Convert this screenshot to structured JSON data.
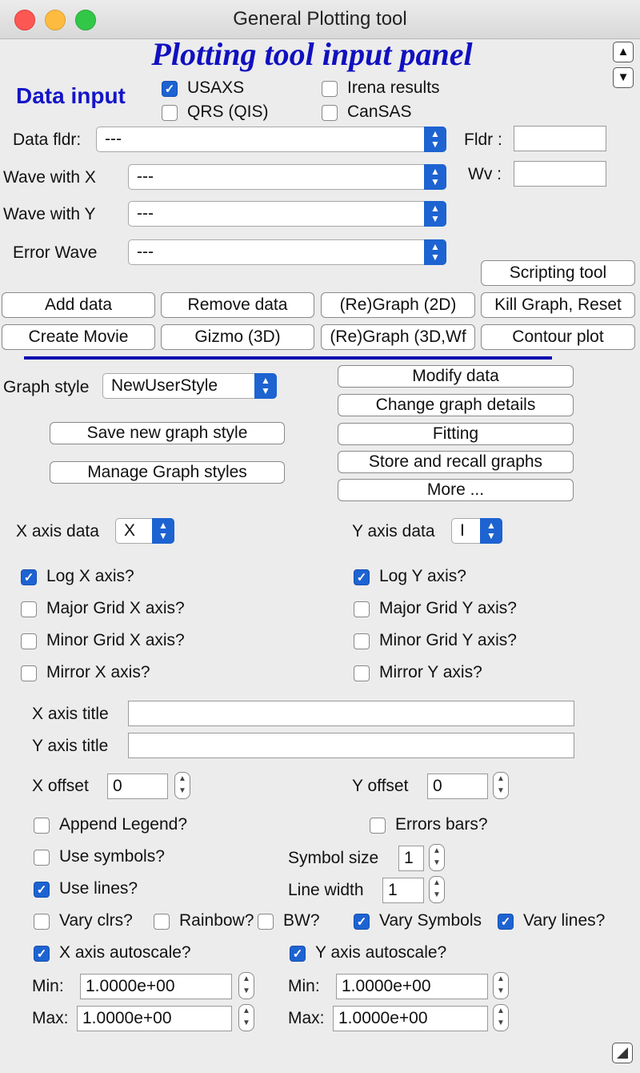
{
  "window": {
    "title": "General Plotting tool"
  },
  "panel_title": "Plotting tool input panel",
  "data_input": {
    "heading": "Data input",
    "sources": [
      {
        "label": "USAXS",
        "checked": true
      },
      {
        "label": "QRS (QIS)",
        "checked": false
      },
      {
        "label": "Irena results",
        "checked": false
      },
      {
        "label": "CanSAS",
        "checked": false
      }
    ],
    "data_folder": {
      "label": "Data fldr:",
      "value": "---"
    },
    "wave_x": {
      "label": "Wave with X",
      "value": "---"
    },
    "wave_y": {
      "label": "Wave with Y",
      "value": "---"
    },
    "error_wave": {
      "label": "Error Wave",
      "value": "---"
    },
    "fldr_filter": {
      "label": "Fldr :",
      "value": ""
    },
    "wv_filter": {
      "label": "Wv :",
      "value": ""
    }
  },
  "buttons": {
    "scripting": "Scripting tool",
    "add_data": "Add data",
    "remove_data": "Remove data",
    "regraph_2d": "(Re)Graph (2D)",
    "kill_graph": "Kill Graph, Reset",
    "create_movie": "Create Movie",
    "gizmo": "Gizmo (3D)",
    "regraph_3d": "(Re)Graph (3D,Wf",
    "contour": "Contour plot",
    "modify_data": "Modify data",
    "change_details": "Change graph details",
    "fitting": "Fitting",
    "store_recall": "Store and recall graphs",
    "more": "More ...",
    "save_style": "Save new graph style",
    "manage_styles": "Manage Graph styles"
  },
  "graph_style": {
    "label": "Graph style",
    "value": "NewUserStyle"
  },
  "x_axis_data": {
    "label": "X axis data",
    "value": "X"
  },
  "y_axis_data": {
    "label": "Y axis data",
    "value": "I"
  },
  "x_axis_opts": [
    {
      "label": "Log X axis?",
      "checked": true
    },
    {
      "label": "Major Grid X axis?",
      "checked": false
    },
    {
      "label": "Minor Grid X axis?",
      "checked": false
    },
    {
      "label": "Mirror X axis?",
      "checked": false
    }
  ],
  "y_axis_opts": [
    {
      "label": "Log Y axis?",
      "checked": true
    },
    {
      "label": "Major Grid Y axis?",
      "checked": false
    },
    {
      "label": "Minor Grid Y axis?",
      "checked": false
    },
    {
      "label": "Mirror Y axis?",
      "checked": false
    }
  ],
  "x_title": {
    "label": "X axis title",
    "value": ""
  },
  "y_title": {
    "label": "Y axis title",
    "value": ""
  },
  "x_offset": {
    "label": "X offset",
    "value": "0"
  },
  "y_offset": {
    "label": "Y offset",
    "value": "0"
  },
  "append_legend": {
    "label": "Append Legend?",
    "checked": false
  },
  "error_bars": {
    "label": "Errors bars?",
    "checked": false
  },
  "use_symbols": {
    "label": "Use symbols?",
    "checked": false
  },
  "symbol_size": {
    "label": "Symbol size",
    "value": "1"
  },
  "use_lines": {
    "label": "Use lines?",
    "checked": true
  },
  "line_width": {
    "label": "Line width",
    "value": "1"
  },
  "vary_clrs": {
    "label": "Vary clrs?",
    "checked": false
  },
  "rainbow": {
    "label": "Rainbow?",
    "checked": false
  },
  "bw": {
    "label": "BW?",
    "checked": false
  },
  "vary_symbols": {
    "label": "Vary Symbols",
    "checked": true
  },
  "vary_lines": {
    "label": "Vary lines?",
    "checked": true
  },
  "x_autoscale": {
    "label": "X axis autoscale?",
    "checked": true
  },
  "y_autoscale": {
    "label": "Y axis autoscale?",
    "checked": true
  },
  "x_min": {
    "label": "Min:",
    "value": "1.0000e+00"
  },
  "x_max": {
    "label": "Max:",
    "value": "1.0000e+00"
  },
  "y_min": {
    "label": "Min:",
    "value": "1.0000e+00"
  },
  "y_max": {
    "label": "Max:",
    "value": "1.0000e+00"
  },
  "colors": {
    "accent": "#1d63d1",
    "title_blue": "#1010c0"
  }
}
